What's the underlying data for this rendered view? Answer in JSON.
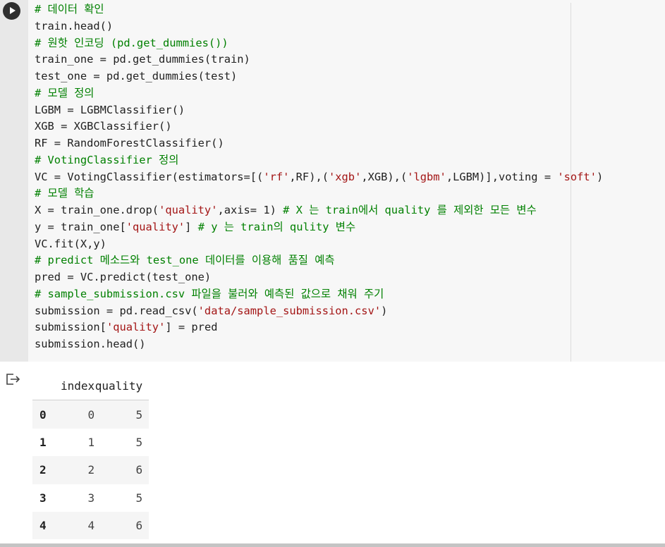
{
  "code_cell": {
    "run_icon": "play-icon",
    "lines": [
      [
        {
          "t": "# 데이터 확인",
          "k": "c"
        }
      ],
      [
        {
          "t": "train.head()"
        }
      ],
      [
        {
          "t": "# 원핫 인코딩 (pd.get_dummies())",
          "k": "c"
        }
      ],
      [
        {
          "t": "train_one = pd.get_dummies(train)"
        }
      ],
      [
        {
          "t": "test_one = pd.get_dummies(test)"
        }
      ],
      [
        {
          "t": "# 모델 정의",
          "k": "c"
        }
      ],
      [
        {
          "t": "LGBM = LGBMClassifier()"
        }
      ],
      [
        {
          "t": "XGB = XGBClassifier()"
        }
      ],
      [
        {
          "t": "RF = RandomForestClassifier()"
        }
      ],
      [
        {
          "t": "# VotingClassifier 정의",
          "k": "c"
        }
      ],
      [
        {
          "t": "VC = VotingClassifier(estimators=[("
        },
        {
          "t": "'rf'",
          "k": "s"
        },
        {
          "t": ",RF),("
        },
        {
          "t": "'xgb'",
          "k": "s"
        },
        {
          "t": ",XGB),("
        },
        {
          "t": "'lgbm'",
          "k": "s"
        },
        {
          "t": ",LGBM)],voting = "
        },
        {
          "t": "'soft'",
          "k": "s"
        },
        {
          "t": ")"
        }
      ],
      [
        {
          "t": "# 모델 학습",
          "k": "c"
        }
      ],
      [
        {
          "t": "X = train_one.drop("
        },
        {
          "t": "'quality'",
          "k": "s"
        },
        {
          "t": ",axis= 1) "
        },
        {
          "t": "# X 는 train에서 quality 를 제외한 모든 변수",
          "k": "c"
        }
      ],
      [
        {
          "t": "y = train_one["
        },
        {
          "t": "'quality'",
          "k": "s"
        },
        {
          "t": "] "
        },
        {
          "t": "# y 는 train의 qulity 변수",
          "k": "c"
        }
      ],
      [
        {
          "t": "VC.fit(X,y)"
        }
      ],
      [
        {
          "t": "# predict 메소드와 test_one 데이터를 이용해 품질 예측",
          "k": "c"
        }
      ],
      [
        {
          "t": "pred = VC.predict(test_one)"
        }
      ],
      [
        {
          "t": "# sample_submission.csv 파일을 불러와 예측된 값으로 채워 주기",
          "k": "c"
        }
      ],
      [
        {
          "t": "submission = pd.read_csv("
        },
        {
          "t": "'data/sample_submission.csv'",
          "k": "s"
        },
        {
          "t": ")"
        }
      ],
      [
        {
          "t": "submission["
        },
        {
          "t": "'quality'",
          "k": "s"
        },
        {
          "t": "] = pred"
        }
      ],
      [
        {
          "t": "submission.head()"
        }
      ]
    ]
  },
  "output": {
    "icon": "output-arrow-icon",
    "table": {
      "columns": [
        "index",
        "quality"
      ],
      "rows": [
        {
          "label": "0",
          "index": "0",
          "quality": "5"
        },
        {
          "label": "1",
          "index": "1",
          "quality": "5"
        },
        {
          "label": "2",
          "index": "2",
          "quality": "6"
        },
        {
          "label": "3",
          "index": "3",
          "quality": "5"
        },
        {
          "label": "4",
          "index": "4",
          "quality": "6"
        }
      ]
    }
  },
  "colors": {
    "comment": "#008000",
    "string": "#a31515",
    "text": "#212121",
    "gutter": "#e8e8e8",
    "editor_bg": "#f7f7f7"
  }
}
